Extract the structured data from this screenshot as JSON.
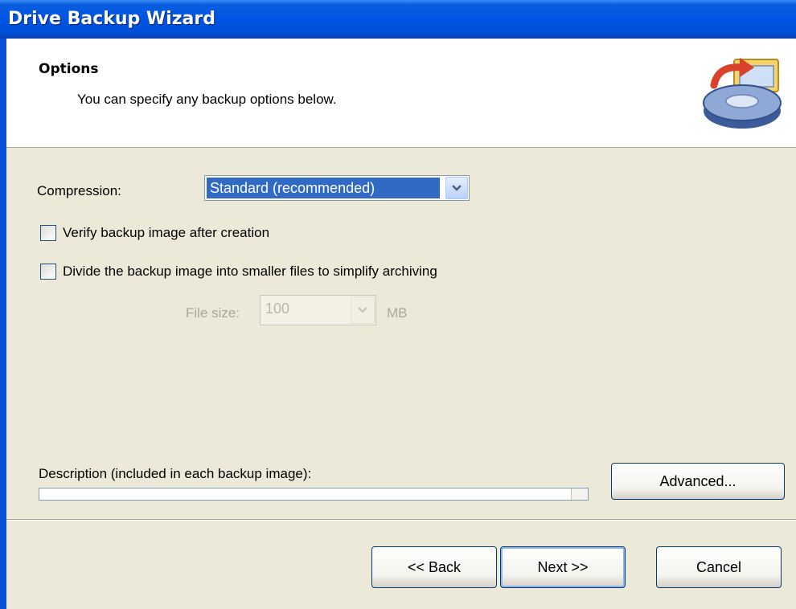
{
  "window": {
    "title": "Drive Backup Wizard"
  },
  "header": {
    "title": "Options",
    "subtitle": "You can specify any backup options below.",
    "icon": "disk-backup-icon"
  },
  "options": {
    "compression_label": "Compression:",
    "compression_value": "Standard (recommended)",
    "verify_label": "Verify backup image after creation",
    "verify_checked": false,
    "divide_label": "Divide the backup image into smaller files to simplify archiving",
    "divide_checked": false,
    "file_size_label": "File size:",
    "file_size_value": "100",
    "file_size_unit": "MB"
  },
  "description": {
    "label": "Description (included in each backup image):",
    "value": ""
  },
  "buttons": {
    "advanced": "Advanced...",
    "back": "<< Back",
    "next": "Next >>",
    "cancel": "Cancel"
  }
}
